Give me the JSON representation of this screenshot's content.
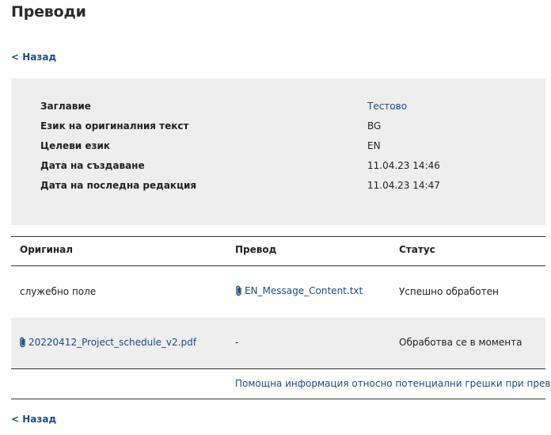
{
  "page": {
    "title": "Преводи",
    "back_label": "< Назад"
  },
  "details": [
    {
      "label": "Заглавие",
      "value": "Тестово"
    },
    {
      "label": "Език на оригиналния текст",
      "value": "BG"
    },
    {
      "label": "Целеви език",
      "value": "EN"
    },
    {
      "label": "Дата на създаване",
      "value": "11.04.23 14:46"
    },
    {
      "label": "Дата на последна редакция",
      "value": "11.04.23 14:47"
    }
  ],
  "table": {
    "headers": {
      "original": "Оригинал",
      "translation": "Превод",
      "status": "Статус"
    },
    "rows": [
      {
        "original": "служебно поле",
        "translation": "EN_Message_Content.txt",
        "status": "Успешно обработен"
      },
      {
        "original": "20220412_Project_schedule_v2.pdf",
        "translation": "-",
        "status": "Обработва се в момента"
      }
    ]
  },
  "help_link": "Помощна информация относно потенциални грешки при превод >",
  "colors": {
    "link": "#1b4b86",
    "panel": "#eeeeee",
    "rule": "#333333"
  },
  "icons": {
    "attachment": "paperclip-icon"
  }
}
